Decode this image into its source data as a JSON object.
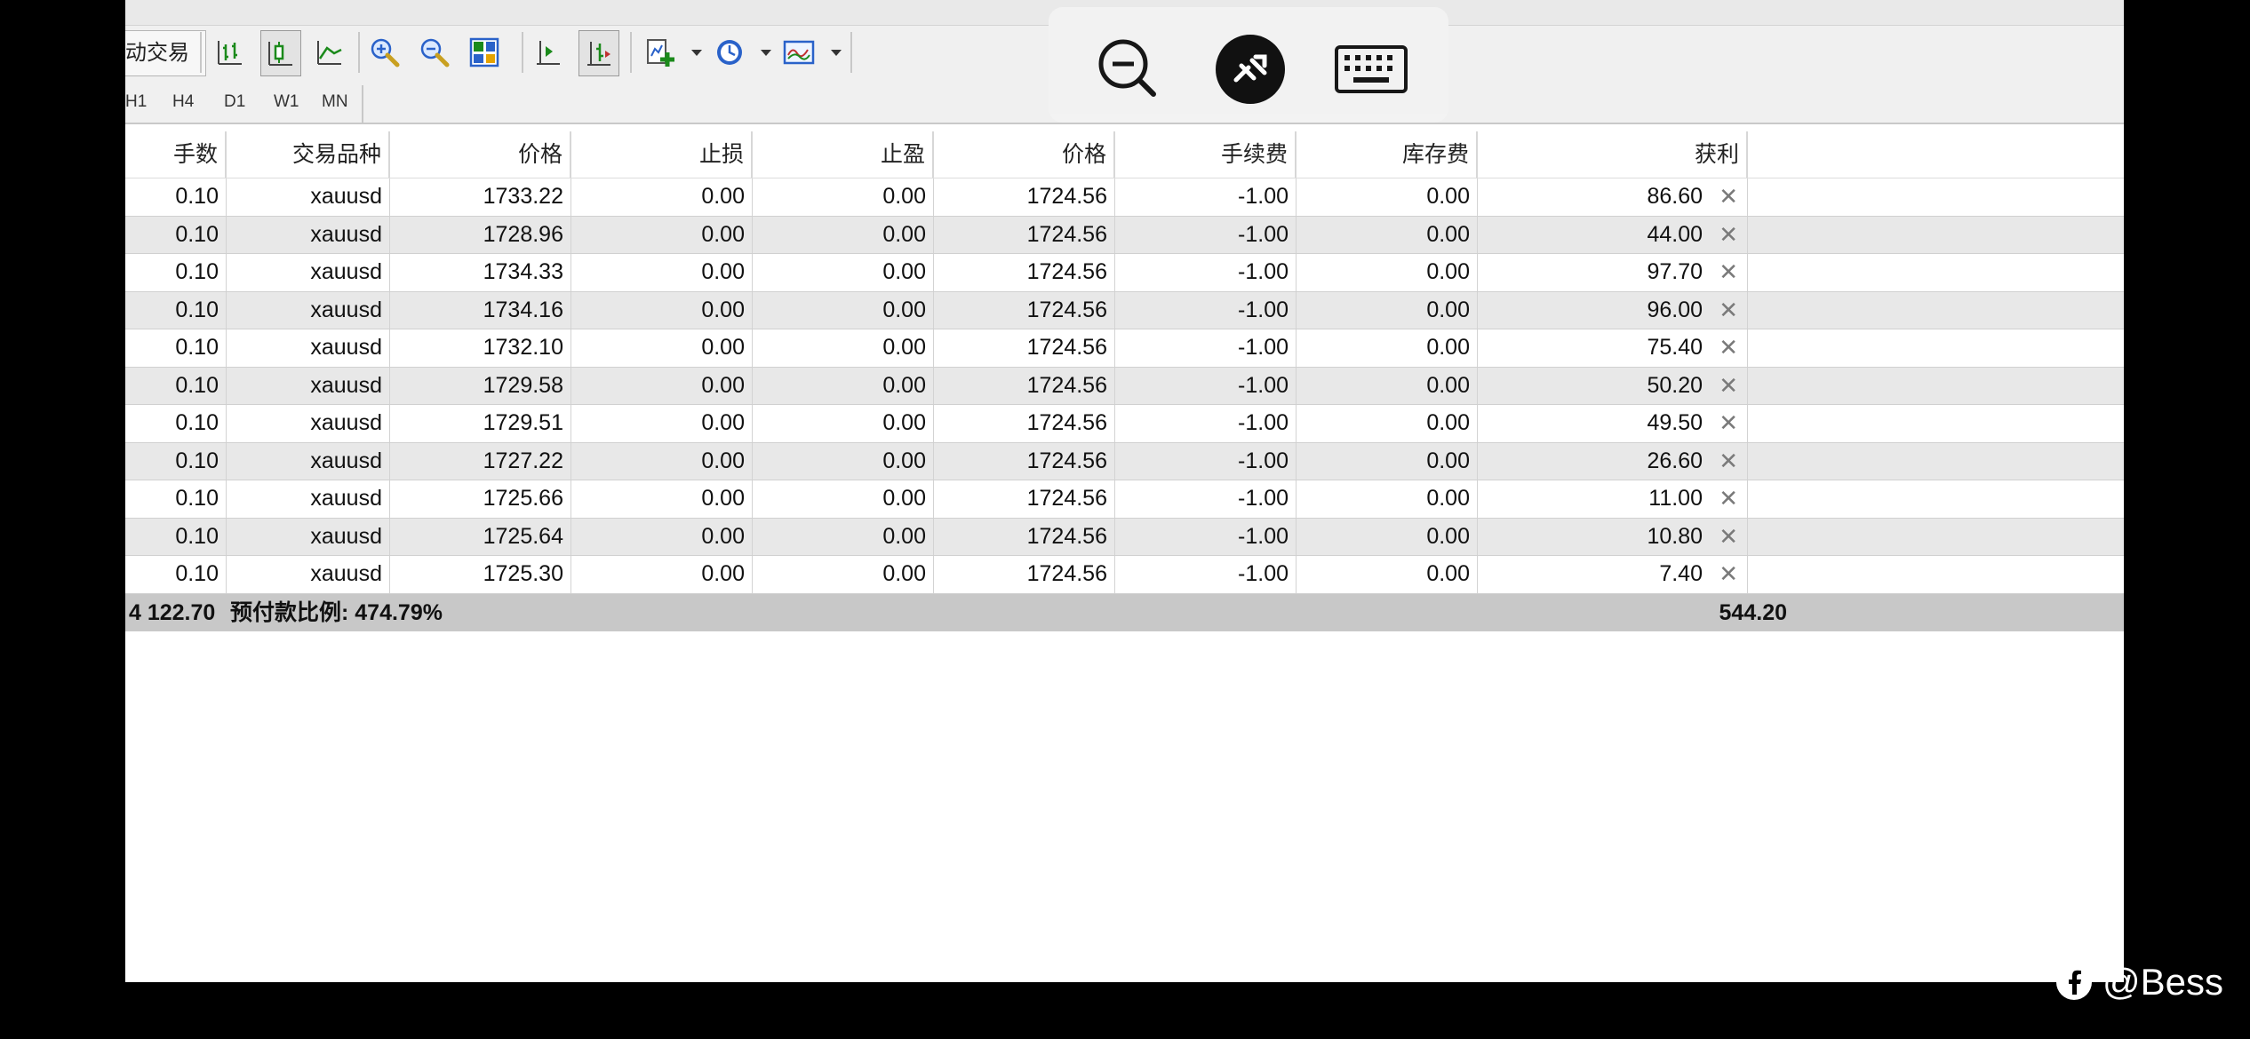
{
  "toolbar": {
    "auto_trade_label": "动交易",
    "timeframes": [
      "H1",
      "H4",
      "D1",
      "W1",
      "MN"
    ],
    "icons": [
      "bar-chart-icon",
      "candlestick-icon",
      "line-chart-icon",
      "zoom-in-icon",
      "zoom-out-icon",
      "tile-windows-icon",
      "chart-shift-icon",
      "autoscroll-icon",
      "indicators-icon",
      "periods-icon",
      "templates-icon"
    ]
  },
  "remote_overlay": {
    "icons": [
      "zoom-out-icon",
      "remote-connect-icon",
      "keyboard-icon"
    ]
  },
  "table": {
    "columns": [
      "手数",
      "交易品种",
      "价格",
      "止损",
      "止盈",
      "价格",
      "手续费",
      "库存费",
      "获利"
    ],
    "rows": [
      [
        "0.10",
        "xauusd",
        "1733.22",
        "0.00",
        "0.00",
        "1724.56",
        "-1.00",
        "0.00",
        "86.60"
      ],
      [
        "0.10",
        "xauusd",
        "1728.96",
        "0.00",
        "0.00",
        "1724.56",
        "-1.00",
        "0.00",
        "44.00"
      ],
      [
        "0.10",
        "xauusd",
        "1734.33",
        "0.00",
        "0.00",
        "1724.56",
        "-1.00",
        "0.00",
        "97.70"
      ],
      [
        "0.10",
        "xauusd",
        "1734.16",
        "0.00",
        "0.00",
        "1724.56",
        "-1.00",
        "0.00",
        "96.00"
      ],
      [
        "0.10",
        "xauusd",
        "1732.10",
        "0.00",
        "0.00",
        "1724.56",
        "-1.00",
        "0.00",
        "75.40"
      ],
      [
        "0.10",
        "xauusd",
        "1729.58",
        "0.00",
        "0.00",
        "1724.56",
        "-1.00",
        "0.00",
        "50.20"
      ],
      [
        "0.10",
        "xauusd",
        "1729.51",
        "0.00",
        "0.00",
        "1724.56",
        "-1.00",
        "0.00",
        "49.50"
      ],
      [
        "0.10",
        "xauusd",
        "1727.22",
        "0.00",
        "0.00",
        "1724.56",
        "-1.00",
        "0.00",
        "26.60"
      ],
      [
        "0.10",
        "xauusd",
        "1725.66",
        "0.00",
        "0.00",
        "1724.56",
        "-1.00",
        "0.00",
        "11.00"
      ],
      [
        "0.10",
        "xauusd",
        "1725.64",
        "0.00",
        "0.00",
        "1724.56",
        "-1.00",
        "0.00",
        "10.80"
      ],
      [
        "0.10",
        "xauusd",
        "1725.30",
        "0.00",
        "0.00",
        "1724.56",
        "-1.00",
        "0.00",
        "7.40"
      ]
    ],
    "summary": {
      "balance_fragment": "4 122.70",
      "margin_level": "预付款比例: 474.79%",
      "total_profit": "544.20"
    }
  },
  "watermark": {
    "handle": "@Bess"
  }
}
